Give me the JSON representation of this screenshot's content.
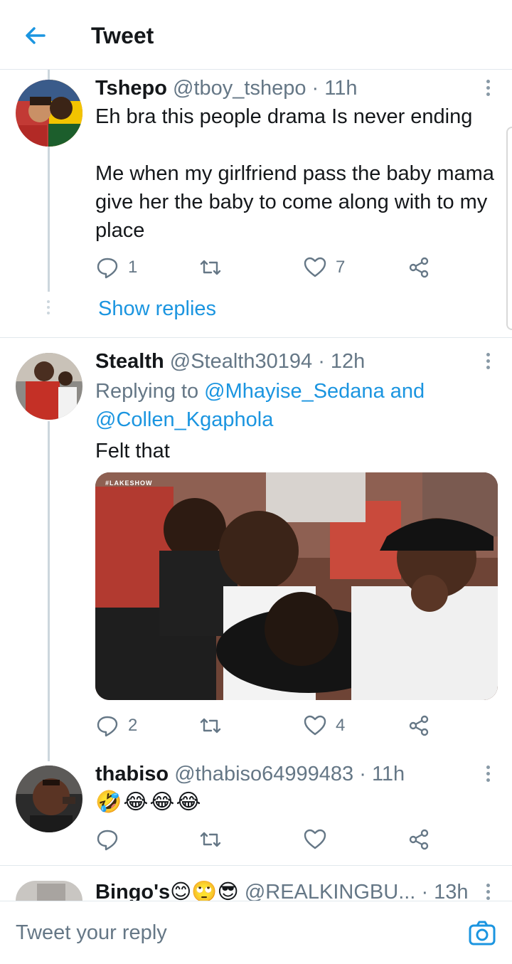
{
  "header": {
    "title": "Tweet"
  },
  "tweets": [
    {
      "name": "Tshepo",
      "handle": "@tboy_tshepo",
      "time": "· 11h",
      "text": "Eh bra this people drama Is never ending\n\nMe when my girlfriend pass the baby mama give her the baby to come along with to my place",
      "replies": "1",
      "retweets": "",
      "likes": "7",
      "show_replies": "Show replies"
    },
    {
      "name": "Stealth",
      "handle": "@Stealth30194",
      "time": "· 12h",
      "replying_prefix": "Replying to",
      "replying_to_1": "@Mhayise_Sedana",
      "replying_and": "and",
      "replying_to_2": "@Collen_Kgaphola",
      "text": "Felt that",
      "image_watermark": "#LAKESHOW",
      "replies": "2",
      "retweets": "",
      "likes": "4"
    },
    {
      "name": "thabiso",
      "handle": "@thabiso64999483",
      "time": "· 11h",
      "text_emoji": "🤣😂😂😂",
      "replies": "",
      "retweets": "",
      "likes": ""
    },
    {
      "name": "Bingo's",
      "name_emoji": "😊🙄😎",
      "handle": "@REALKINGBU...",
      "time": "· 13h"
    }
  ],
  "reply_box": {
    "placeholder": "Tweet your reply"
  },
  "colors": {
    "accent": "#1b95e0",
    "muted": "#657786",
    "divider": "#e1e8ed"
  }
}
